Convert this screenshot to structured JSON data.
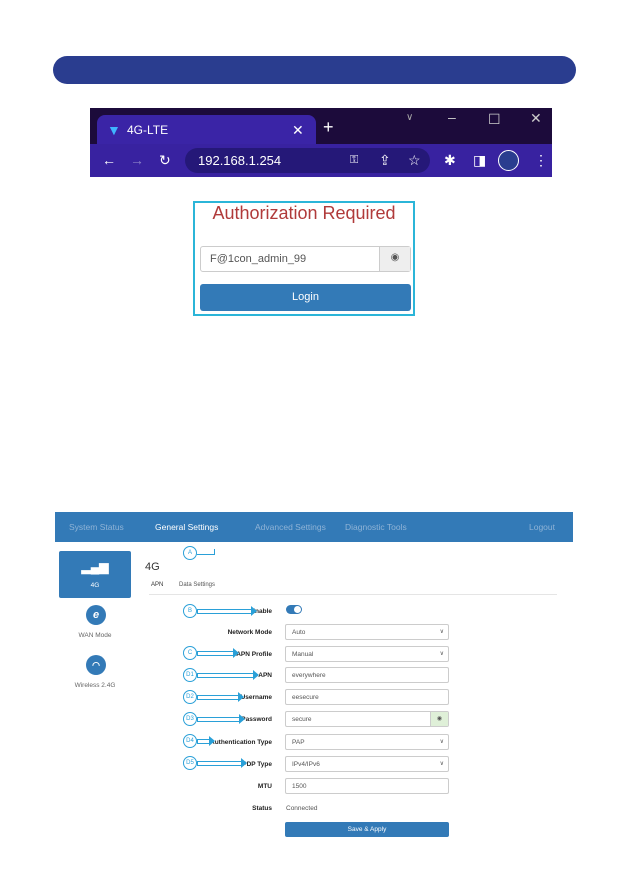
{
  "browser": {
    "tab_title": "4G-LTE",
    "url": "192.168.1.254",
    "icons": [
      "wifi-icon",
      "close-icon",
      "new-tab-icon",
      "back-icon",
      "forward-icon",
      "reload-icon",
      "key-icon",
      "share-icon",
      "star-icon",
      "extensions-icon",
      "sidepanel-icon",
      "profile-avatar",
      "menu-icon"
    ]
  },
  "login": {
    "title": "Authorization Required",
    "password_value": "F@1con_admin_99",
    "button": "Login"
  },
  "router": {
    "nav": [
      {
        "label": "System Status"
      },
      {
        "label": "General Settings"
      },
      {
        "label": "Advanced Settings"
      },
      {
        "label": "Diagnostic Tools"
      },
      {
        "label": "Logout"
      }
    ],
    "sidebar": [
      {
        "label": "4G"
      },
      {
        "label": "WAN Mode"
      },
      {
        "label": "Wireless 2.4G"
      }
    ],
    "title": "4G",
    "tabs": [
      {
        "label": "APN"
      },
      {
        "label": "Data Settings"
      }
    ],
    "form": {
      "enable": {
        "label": "Enable",
        "value": true
      },
      "network_mode": {
        "label": "Network Mode",
        "value": "Auto"
      },
      "apn_profile": {
        "label": "APN Profile",
        "value": "Manual"
      },
      "apn": {
        "label": "APN",
        "value": "everywhere"
      },
      "username": {
        "label": "Username",
        "value": "eesecure"
      },
      "password": {
        "label": "Password",
        "value": "secure"
      },
      "auth_type": {
        "label": "Authentication Type",
        "value": "PAP"
      },
      "pdp_type": {
        "label": "PDP Type",
        "value": "IPv4/IPv6"
      },
      "mtu": {
        "label": "MTU",
        "value": "1500"
      },
      "status": {
        "label": "Status",
        "value": "Connected"
      },
      "save": "Save & Apply"
    },
    "annotations": [
      "A",
      "B",
      "C",
      "D1",
      "D2",
      "D3",
      "D4",
      "D5"
    ]
  },
  "colors": {
    "header_bar": "#2a3d8f",
    "router_accent": "#337ab7",
    "annotation": "#2aa0d8",
    "login_title": "#b03a3a"
  }
}
